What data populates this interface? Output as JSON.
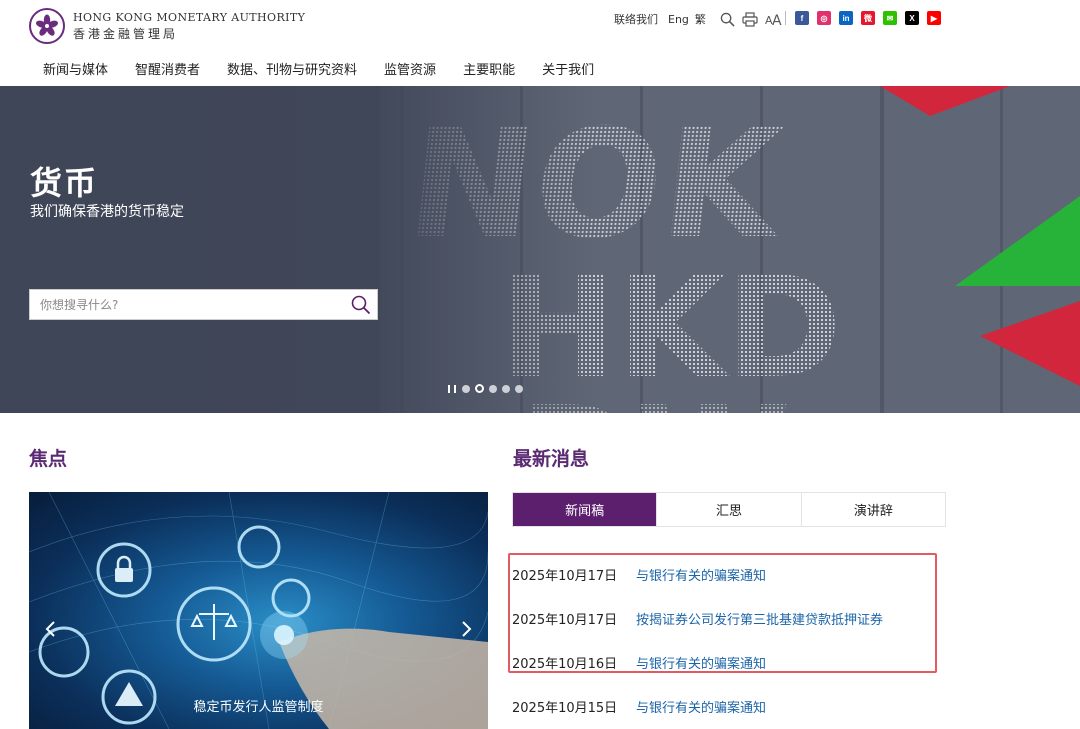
{
  "header": {
    "brand_en": "HONG KONG MONETARY AUTHORITY",
    "brand_zh": "香港金融管理局",
    "utils": {
      "contact": "联络我们",
      "eng": "Eng",
      "trad": "繁"
    },
    "icons": [
      "search-icon",
      "print-icon",
      "font-size-icon"
    ],
    "social": [
      {
        "name": "facebook",
        "color": "#3b5998",
        "glyph": "f"
      },
      {
        "name": "instagram",
        "color": "#e1306c",
        "glyph": "◎"
      },
      {
        "name": "linkedin",
        "color": "#0a66c2",
        "glyph": "in"
      },
      {
        "name": "weibo",
        "color": "#e6162d",
        "glyph": "微"
      },
      {
        "name": "wechat",
        "color": "#2dc100",
        "glyph": "✉"
      },
      {
        "name": "x",
        "color": "#000000",
        "glyph": "X"
      },
      {
        "name": "youtube",
        "color": "#ff0000",
        "glyph": "▶"
      }
    ]
  },
  "nav": [
    "新闻与媒体",
    "智醒消费者",
    "数据、刊物与研究资料",
    "监管资源",
    "主要职能",
    "关于我们"
  ],
  "hero": {
    "title": "货币",
    "subtitle": "我们确保香港的货币稳定",
    "search_placeholder": "你想搜寻什么?",
    "slides": 5,
    "active_slide": 1
  },
  "focus": {
    "title": "焦点",
    "caption": "稳定币发行人监管制度"
  },
  "news": {
    "title": "最新消息",
    "tabs": [
      "新闻稿",
      "汇思",
      "演讲辞"
    ],
    "active_tab": 0,
    "items": [
      {
        "date": "2025年10月17日",
        "title": "与银行有关的骗案通知"
      },
      {
        "date": "2025年10月17日",
        "title": "按揭证券公司发行第三批基建贷款抵押证券"
      },
      {
        "date": "2025年10月16日",
        "title": "与银行有关的骗案通知"
      },
      {
        "date": "2025年10月15日",
        "title": "与银行有关的骗案通知"
      }
    ]
  },
  "colors": {
    "brand_purple": "#5c1f6e",
    "link_blue": "#1b64a8",
    "highlight_red": "#e35a62"
  }
}
